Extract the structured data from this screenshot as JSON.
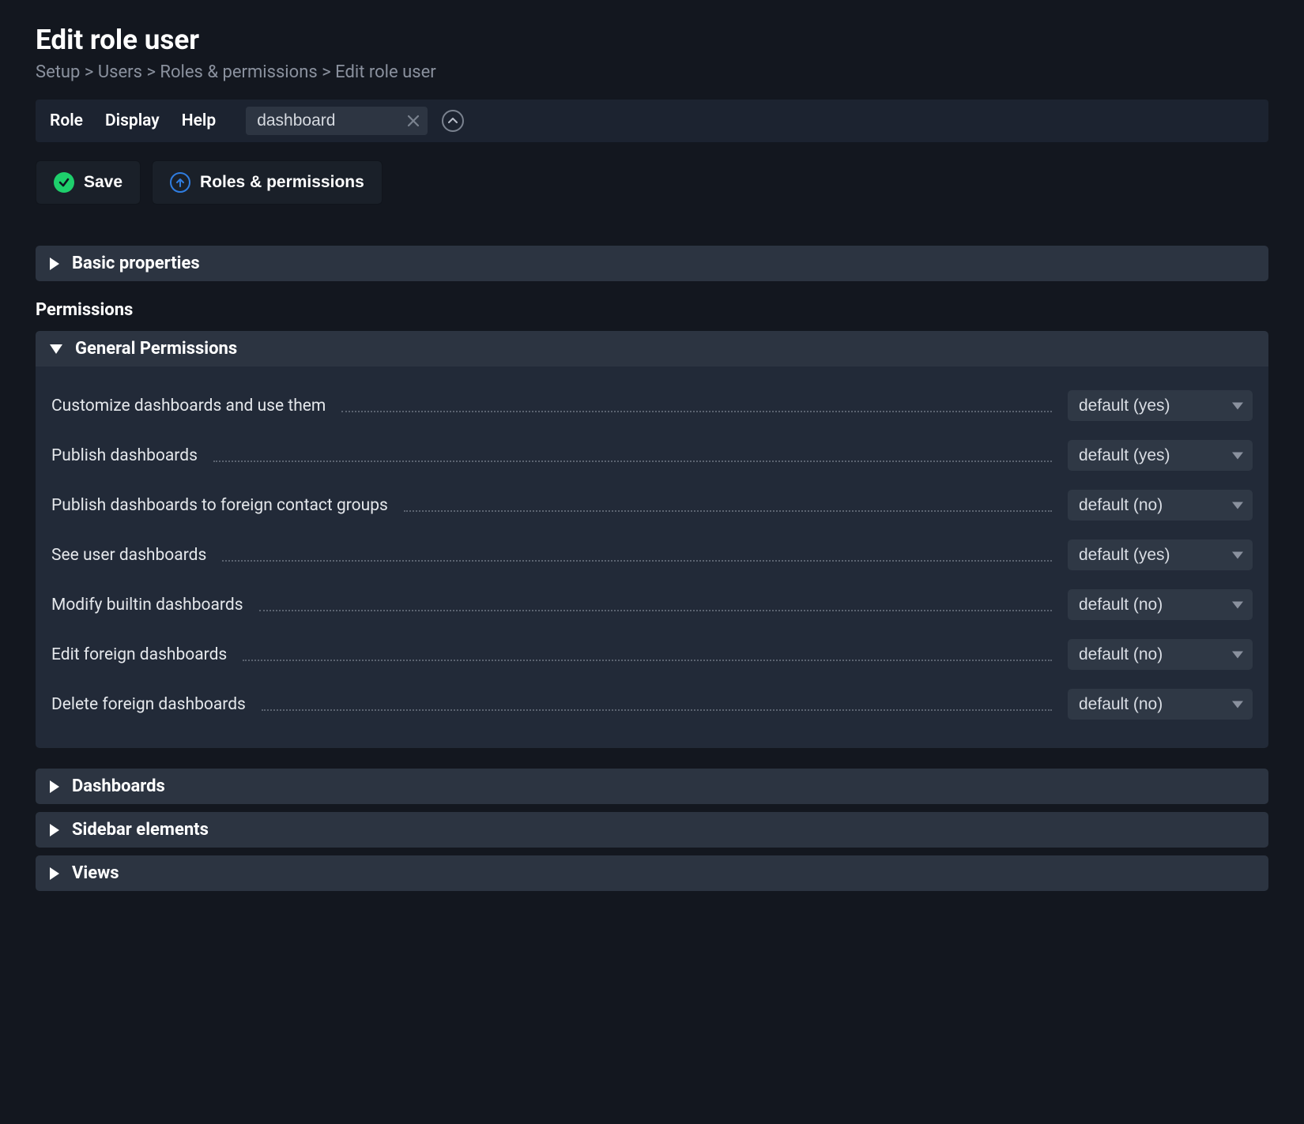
{
  "page": {
    "title": "Edit role user"
  },
  "breadcrumb": {
    "parts": [
      "Setup",
      "Users",
      "Roles & permissions",
      "Edit role user"
    ],
    "separator": " > "
  },
  "toolbar": {
    "items": [
      "Role",
      "Display",
      "Help"
    ],
    "search_value": "dashboard"
  },
  "actions": {
    "save": "Save",
    "roles_permissions": "Roles & permissions"
  },
  "sections": {
    "basic_properties": "Basic properties",
    "permissions_heading": "Permissions",
    "general_permissions": "General Permissions",
    "dashboards": "Dashboards",
    "sidebar_elements": "Sidebar elements",
    "views": "Views"
  },
  "permissions": [
    {
      "label": "Customize dashboards and use them",
      "value": "default (yes)"
    },
    {
      "label": "Publish dashboards",
      "value": "default (yes)"
    },
    {
      "label": "Publish dashboards to foreign contact groups",
      "value": "default (no)"
    },
    {
      "label": "See user dashboards",
      "value": "default (yes)"
    },
    {
      "label": "Modify builtin dashboards",
      "value": "default (no)"
    },
    {
      "label": "Edit foreign dashboards",
      "value": "default (no)"
    },
    {
      "label": "Delete foreign dashboards",
      "value": "default (no)"
    }
  ]
}
